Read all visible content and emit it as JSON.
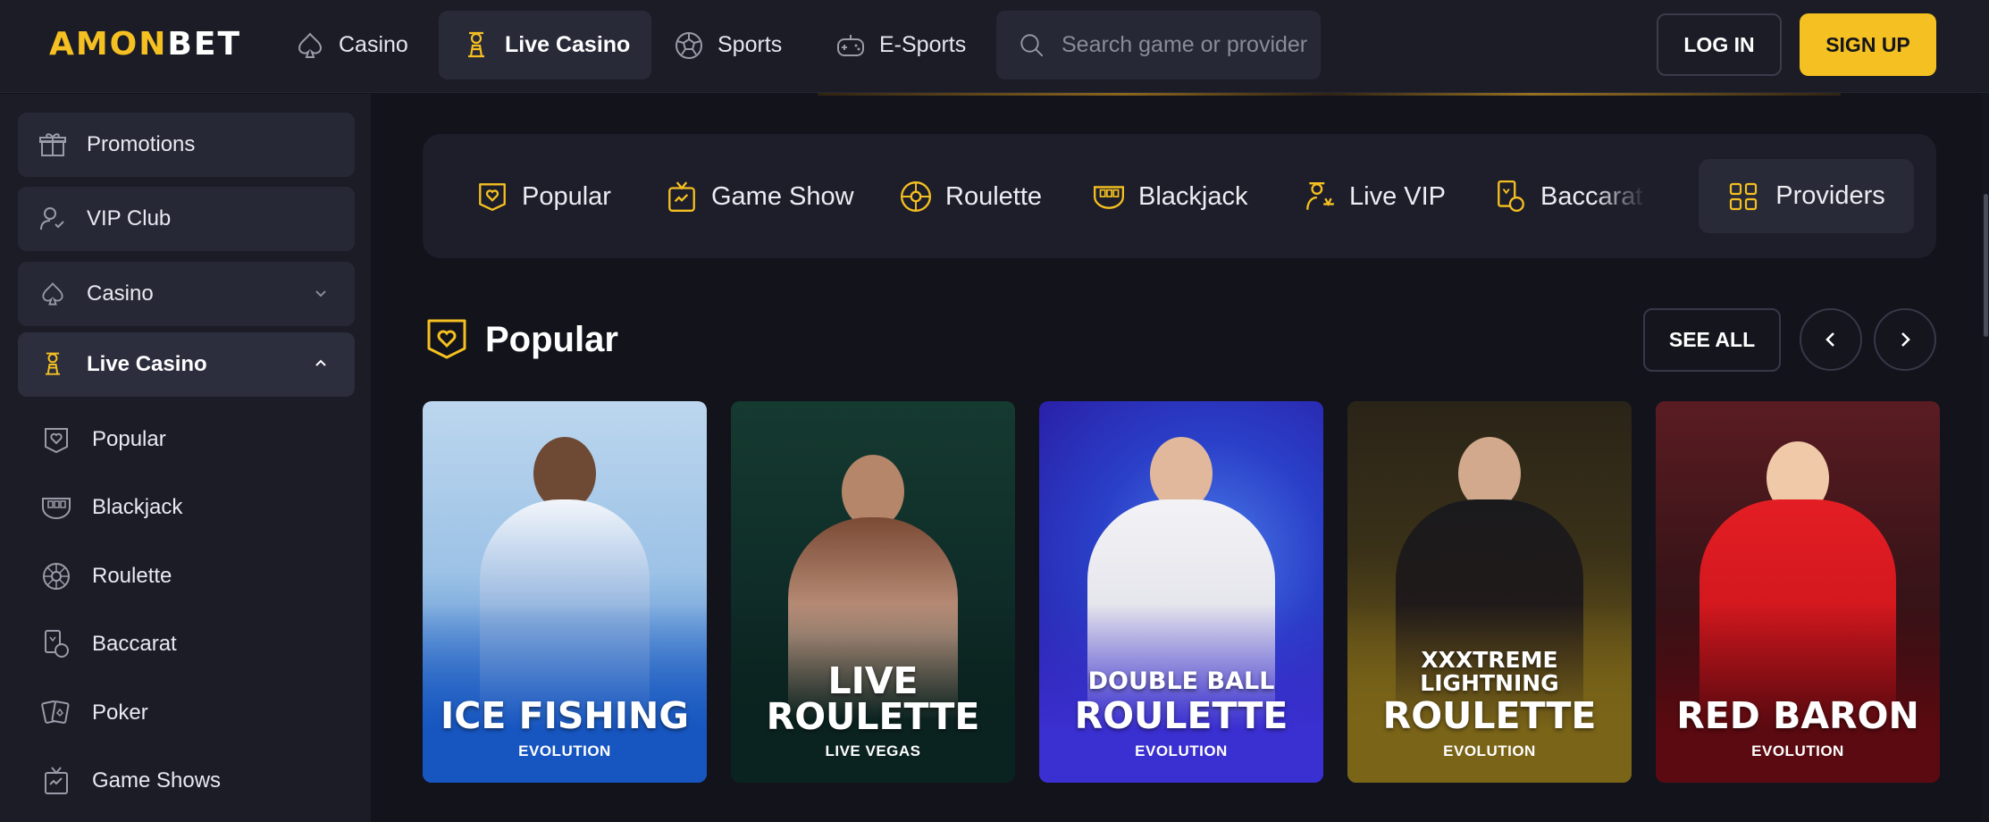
{
  "brand": {
    "logo_a": "AMON",
    "logo_b": "BET",
    "accent": "#f5c021"
  },
  "nav": {
    "items": [
      {
        "label": "Casino",
        "icon": "spade-icon"
      },
      {
        "label": "Live Casino",
        "icon": "dealer-icon",
        "active": true
      },
      {
        "label": "Sports",
        "icon": "soccer-ball-icon"
      },
      {
        "label": "E-Sports",
        "icon": "gamepad-icon"
      }
    ],
    "search_placeholder": "Search game or provider",
    "login_label": "LOG IN",
    "signup_label": "SIGN UP"
  },
  "sidebar": {
    "items": [
      {
        "label": "Promotions",
        "icon": "gift-icon"
      },
      {
        "label": "VIP Club",
        "icon": "vip-user-icon"
      },
      {
        "label": "Casino",
        "icon": "spade-icon",
        "expandable": true
      },
      {
        "label": "Live Casino",
        "icon": "dealer-icon",
        "expanded": true
      }
    ],
    "sub_items": [
      {
        "label": "Popular",
        "icon": "heart-badge-icon"
      },
      {
        "label": "Blackjack",
        "icon": "blackjack-icon"
      },
      {
        "label": "Roulette",
        "icon": "roulette-icon"
      },
      {
        "label": "Baccarat",
        "icon": "baccarat-icon"
      },
      {
        "label": "Poker",
        "icon": "poker-cards-icon"
      },
      {
        "label": "Game Shows",
        "icon": "tv-show-icon"
      }
    ]
  },
  "categories": {
    "items": [
      {
        "label": "Popular",
        "icon": "heart-badge-icon"
      },
      {
        "label": "Game Show",
        "icon": "tv-show-icon"
      },
      {
        "label": "Roulette",
        "icon": "roulette-icon"
      },
      {
        "label": "Blackjack",
        "icon": "blackjack-icon"
      },
      {
        "label": "Live VIP",
        "icon": "vip-dealer-icon"
      },
      {
        "label": "Baccarat",
        "icon": "baccarat-icon"
      }
    ],
    "providers_label": "Providers"
  },
  "section": {
    "title": "Popular",
    "see_all_label": "SEE ALL"
  },
  "games": [
    {
      "line1": "",
      "line2": "ICE FISHING",
      "provider": "EVOLUTION",
      "theme": "ice"
    },
    {
      "line1": "LIVE",
      "line2": "ROULETTE",
      "provider": "LIVE VEGAS",
      "theme": "green"
    },
    {
      "line1": "DOUBLE BALL",
      "line2": "ROULETTE",
      "provider": "EVOLUTION",
      "theme": "blue"
    },
    {
      "line1": "XXXTREME LIGHTNING",
      "line2": "ROULETTE",
      "provider": "EVOLUTION",
      "theme": "gold"
    },
    {
      "line1": "",
      "line2": "RED BARON",
      "provider": "EVOLUTION",
      "theme": "red"
    }
  ]
}
